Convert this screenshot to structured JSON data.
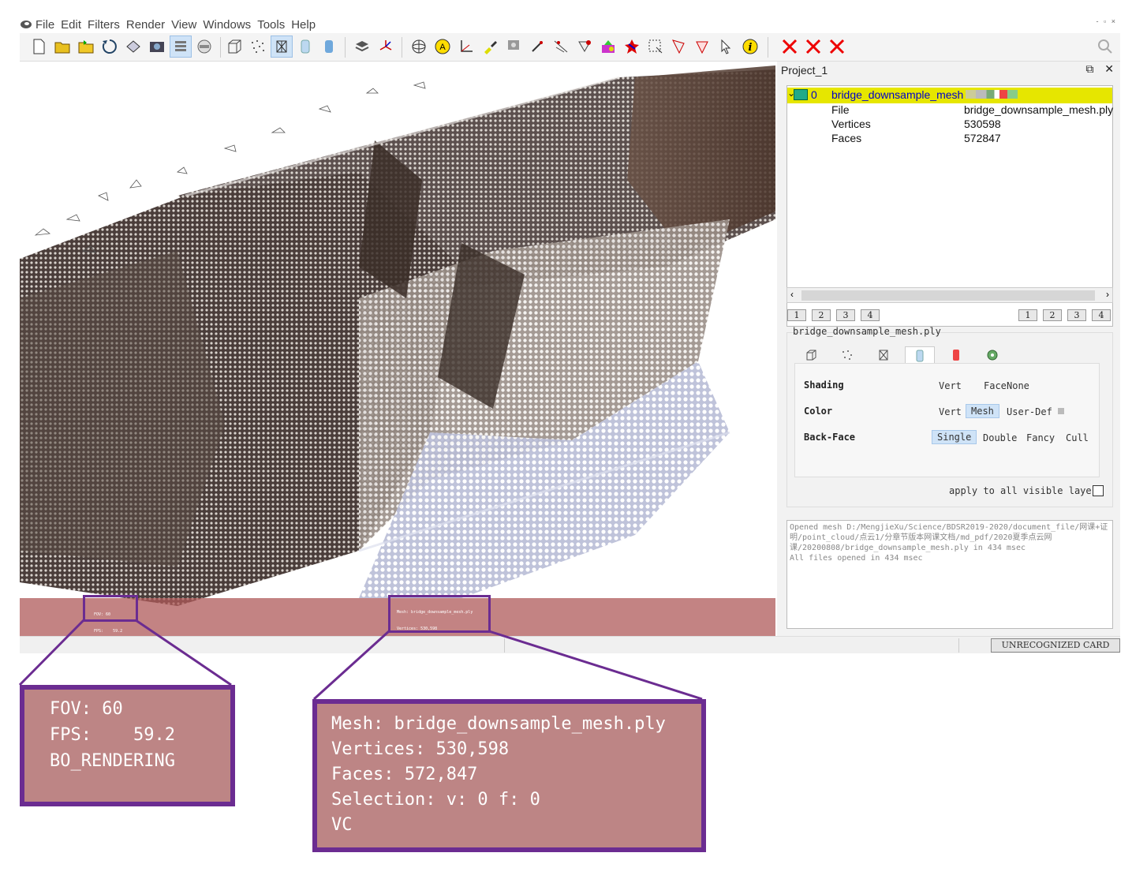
{
  "menubar": {
    "items": [
      "File",
      "Edit",
      "Filters",
      "Render",
      "View",
      "Windows",
      "Tools",
      "Help"
    ],
    "window_controls": "- ▫ ×"
  },
  "toolbar": {
    "icons": [
      "new-icon",
      "open-icon",
      "open-project-icon",
      "reload-icon",
      "save-icon",
      "snapshot-icon",
      "layers-icon",
      "raster-icon",
      "bbox-icon",
      "points-icon",
      "wireframe-icon",
      "flat-icon",
      "smooth-icon",
      "texture-icon",
      "axis-icon",
      "sphere-icon",
      "annotation-icon",
      "measure-icon",
      "paint-icon",
      "raster-align-icon",
      "pick-icon",
      "select-vertex-icon",
      "select-face-icon",
      "color-icon",
      "georef-icon",
      "select-rect-icon",
      "edit-icon",
      "edit2-icon",
      "select-pointer-icon",
      "info-icon",
      "delete-face-icon",
      "delete-vertex-icon",
      "delete-all-icon",
      "search-icon"
    ],
    "georef_label": "GEOREF",
    "raster_label": "Raster alignment"
  },
  "panel": {
    "title": "Project_1",
    "tree": {
      "index": "0",
      "layer_name": "bridge_downsample_mesh",
      "rows": [
        {
          "key": "File",
          "value": "bridge_downsample_mesh.ply"
        },
        {
          "key": "Vertices",
          "value": "530598"
        },
        {
          "key": "Faces",
          "value": "572847"
        }
      ]
    },
    "numbuttons_left": [
      "1",
      "2",
      "3",
      "4"
    ],
    "numbuttons_right": [
      "1",
      "2",
      "3",
      "4"
    ],
    "layer_file": "bridge_downsample_mesh.ply",
    "props": {
      "shading": {
        "label": "Shading",
        "options": [
          "Vert",
          "Face",
          "None"
        ]
      },
      "color": {
        "label": "Color",
        "options": [
          "Vert",
          "Mesh",
          "User-Def"
        ],
        "selected": "Mesh"
      },
      "backface": {
        "label": "Back-Face",
        "options": [
          "Single",
          "Double",
          "Fancy",
          "Cull"
        ],
        "selected": "Single"
      }
    },
    "apply_all": "apply to all visible layers",
    "log": [
      "Opened mesh D:/MengjieXu/Science/BDSR2019-2020/document_file/网课+证明/point_cloud/点云1/分章节版本网课文档/md_pdf/2020夏季点云网课/20200808/bridge_downsample_mesh.ply in 434 msec",
      "All files opened in 434 msec"
    ]
  },
  "status": {
    "card": "UNRECOGNIZED CARD"
  },
  "hud": {
    "left": [
      "FOV: 60",
      "FPS:    59.2",
      "BO_RENDERING"
    ],
    "right": [
      "Mesh: bridge_downsample_mesh.ply",
      "Vertices: 530,598",
      "Faces: 572,847",
      "Selection: v: 0 f: 0",
      "VC"
    ]
  },
  "colors": {
    "hud_bg": "#bd8585",
    "callout": "#6b2c91",
    "selected_row": "#e6e600",
    "accent": "#cfe3f7"
  }
}
